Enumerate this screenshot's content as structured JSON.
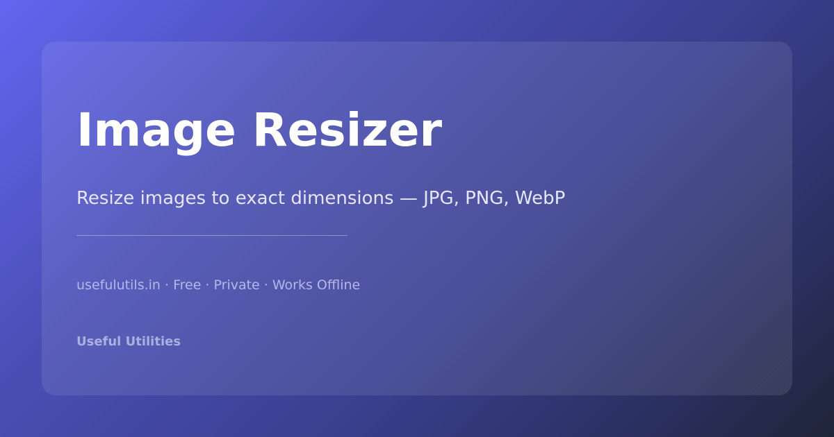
{
  "card": {
    "title": "Image Resizer",
    "subtitle": "Resize images to exact dimensions — JPG, PNG, WebP",
    "meta": "usefulutils.in · Free · Private · Works Offline",
    "brand": "Useful Utilities"
  },
  "colors": {
    "gradient_start": "#6366f1",
    "gradient_end": "#1f2538",
    "title_text": "#ffffff",
    "subtitle_text": "#e6e7fb",
    "meta_text": "#b4b8ea",
    "brand_text": "#aab0e0"
  }
}
